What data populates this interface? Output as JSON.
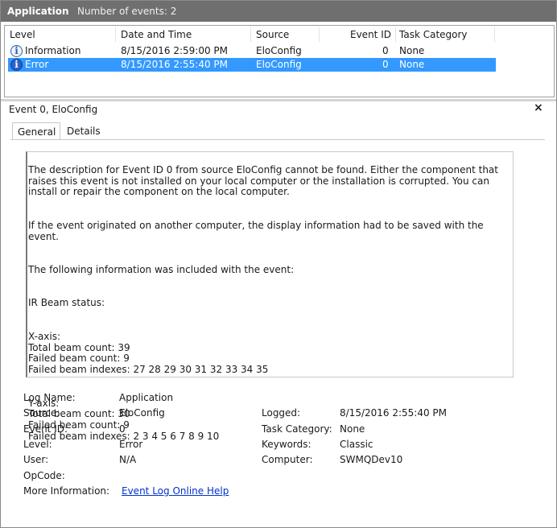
{
  "header": {
    "app": "Application",
    "count": "Number of events: 2"
  },
  "columns": [
    "Level",
    "Date and Time",
    "Source",
    "Event ID",
    "Task Category"
  ],
  "events": [
    {
      "level": "Information",
      "datetime": "8/15/2016 2:59:00 PM",
      "source": "EloConfig",
      "event_id": "0",
      "task": "None"
    },
    {
      "level": "Error",
      "datetime": "8/15/2016 2:55:40 PM",
      "source": "EloConfig",
      "event_id": "0",
      "task": "None"
    }
  ],
  "detail": {
    "title": "Event 0, EloConfig",
    "close": "×",
    "tabs": [
      "General",
      "Details"
    ],
    "description": [
      "The description for Event ID 0 from source EloConfig cannot be found. Either the component that raises this event is not installed on your local computer or the installation is corrupted. You can install or repair the component on the local computer.",
      "If the event originated on another computer, the display information had to be saved with the event.",
      "The following information was included with the event:",
      "IR Beam status:",
      "X-axis:\nTotal beam count: 39\nFailed beam count: 9\nFailed beam indexes: 27 28 29 30 31 32 33 34 35",
      "Y-axis:\nTotal beam count: 30\nFailed beam count: 9\nFailed beam indexes: 2 3 4 5 6 7 8 9 10"
    ],
    "props": {
      "log_name_label": "Log Name:",
      "log_name": "Application",
      "source_label": "Source:",
      "source": "EloConfig",
      "logged_label": "Logged:",
      "logged": "8/15/2016 2:55:40 PM",
      "event_id_label": "Event ID:",
      "event_id": "0",
      "task_label": "Task Category:",
      "task": "None",
      "level_label": "Level:",
      "level": "Error",
      "keywords_label": "Keywords:",
      "keywords": "Classic",
      "user_label": "User:",
      "user": "N/A",
      "computer_label": "Computer:",
      "computer": "SWMQDev10",
      "opcode_label": "OpCode:",
      "more_info_label": "More Information:",
      "more_info_link": "Event Log Online Help"
    }
  }
}
